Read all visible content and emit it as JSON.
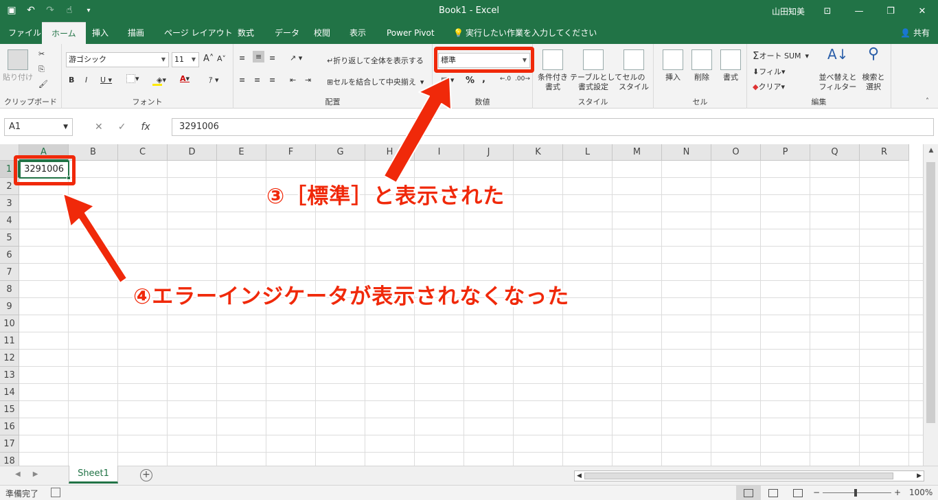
{
  "window": {
    "title": "Book1  -  Excel",
    "user": "山田知美",
    "share": "共有"
  },
  "tabs": [
    {
      "label": "ファイル"
    },
    {
      "label": "ホーム"
    },
    {
      "label": "挿入"
    },
    {
      "label": "描画"
    },
    {
      "label": "ページ レイアウト"
    },
    {
      "label": "数式"
    },
    {
      "label": "データ"
    },
    {
      "label": "校閲"
    },
    {
      "label": "表示"
    },
    {
      "label": "Power Pivot"
    },
    {
      "label": "実行したい作業を入力してください"
    }
  ],
  "ribbon": {
    "clipboard": {
      "paste": "貼り付け",
      "label": "クリップボード"
    },
    "font": {
      "name": "游ゴシック",
      "size": "11",
      "label": "フォント"
    },
    "alignment": {
      "wrap": "折り返して全体を表示する",
      "merge": "セルを結合して中央揃え",
      "label": "配置"
    },
    "number": {
      "format": "標準",
      "label": "数値"
    },
    "styles": {
      "conditional": "条件付き\n書式",
      "table": "テーブルとして\n書式設定",
      "cellstyle": "セルの\nスタイル",
      "label": "スタイル"
    },
    "cells": {
      "insert": "挿入",
      "delete": "削除",
      "format": "書式",
      "label": "セル"
    },
    "editing": {
      "autosum": "オート SUM",
      "fill": "フィル",
      "clear": "クリア",
      "sort": "並べ替えと\nフィルター",
      "find": "検索と\n選択",
      "label": "編集"
    }
  },
  "formula_bar": {
    "name_box": "A1",
    "formula": "3291006"
  },
  "columns": [
    "A",
    "B",
    "C",
    "D",
    "E",
    "F",
    "G",
    "H",
    "I",
    "J",
    "K",
    "L",
    "M",
    "N",
    "O",
    "P",
    "Q",
    "R"
  ],
  "rows": [
    "1",
    "2",
    "3",
    "4",
    "5",
    "6",
    "7",
    "8",
    "9",
    "10",
    "11",
    "12",
    "13",
    "14",
    "15",
    "16",
    "17",
    "18"
  ],
  "active_cell": {
    "ref": "A1",
    "value": "3291006"
  },
  "sheet_tab": "Sheet1",
  "status": {
    "ready": "準備完了",
    "zoom": "100%"
  },
  "annotations": {
    "a3": "③［標準］と表示された",
    "a4": "④エラーインジケータが表示されなくなった"
  },
  "colors": {
    "accent": "#217346",
    "annotation": "#f0290a"
  }
}
